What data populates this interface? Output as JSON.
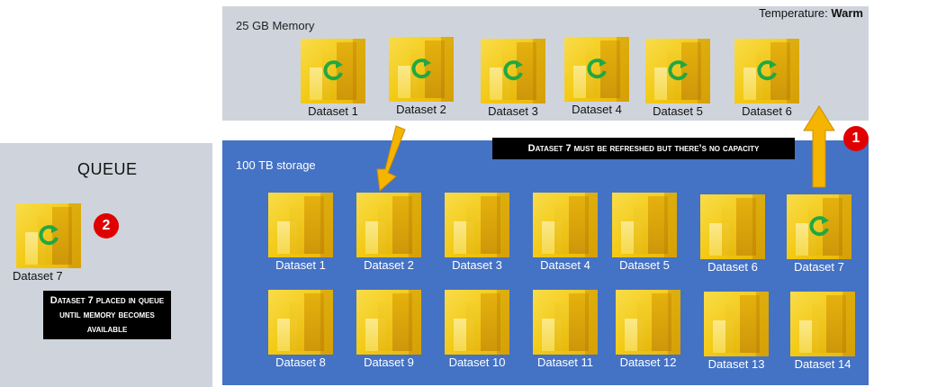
{
  "memory": {
    "label": "25 GB Memory",
    "temperature_prefix": "Temperature: ",
    "temperature_value": "Warm",
    "datasets": [
      "Dataset 1",
      "Dataset 2",
      "Dataset 3",
      "Dataset 4",
      "Dataset 5",
      "Dataset 6"
    ]
  },
  "storage": {
    "label": "100 TB storage",
    "datasets": [
      "Dataset 1",
      "Dataset 2",
      "Dataset 3",
      "Dataset 4",
      "Dataset 5",
      "Dataset 6",
      "Dataset 7",
      "Dataset 8",
      "Dataset 9",
      "Dataset 10",
      "Dataset 11",
      "Dataset 12",
      "Dataset 13",
      "Dataset 14"
    ]
  },
  "queue": {
    "title": "QUEUE",
    "dataset": "Dataset 7",
    "note": "Dataset 7 placed in queue until memory becomes available"
  },
  "notes": {
    "capacity": "Dataset 7 must be refreshed but there’s no capacity"
  },
  "badges": {
    "one": "1",
    "two": "2"
  },
  "colors": {
    "memory_panel": "#cfd4dc",
    "storage_panel": "#4472c4",
    "queue_panel": "#cfd4dc",
    "arrow": "#f5b400",
    "badge": "#e00000",
    "refresh_icon": "#1fa843"
  }
}
